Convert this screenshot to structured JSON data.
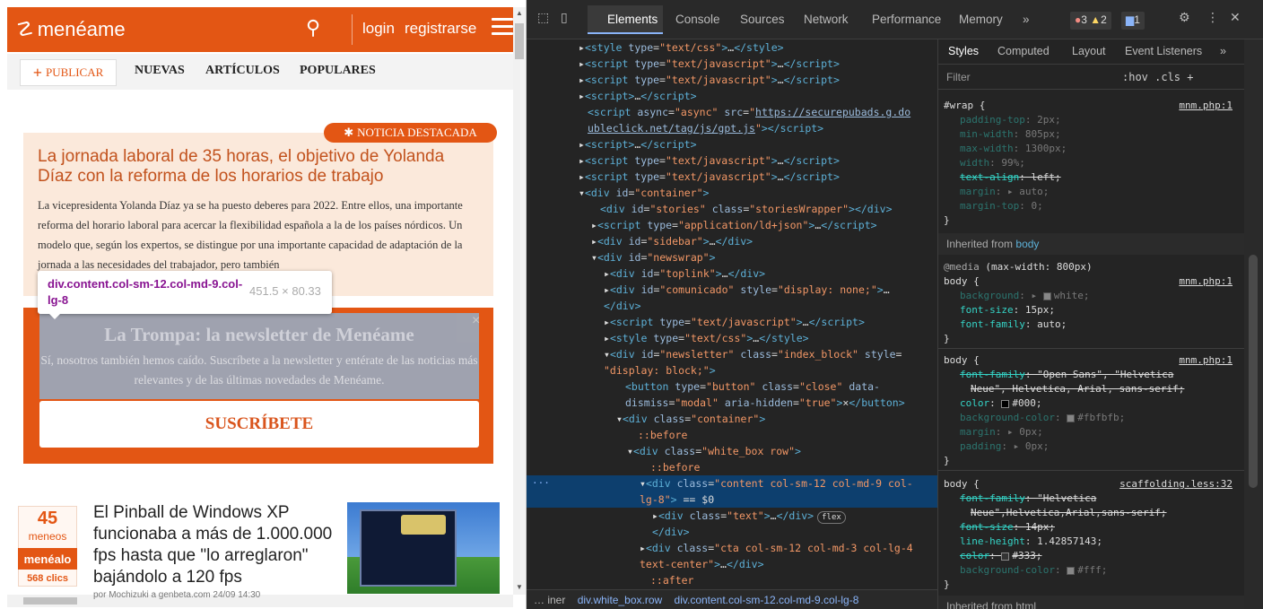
{
  "page": {
    "logo": "menéame",
    "login": "login",
    "register": "registrarse",
    "publish": "PUBLICAR",
    "nav": [
      "NUEVAS",
      "ARTÍCULOS",
      "POPULARES"
    ],
    "featured_badge": "NOTICIA DESTACADA",
    "featured_title": "La jornada laboral de 35 horas, el objetivo de Yolanda Díaz con la reforma de los horarios de trabajo",
    "featured_body": "La vicepresidenta Yolanda Díaz ya se ha puesto deberes para 2022. Entre ellos, una importante reforma del horario laboral para acercar la flexibilidad española a la de los países nórdicos. Un modelo que, según los expertos, se distingue por una importante capacidad de adaptación de la jornada a las necesidades del trabajador, pero también",
    "tooltip_selector": "div.content.col-sm-12.col-md-9.col-lg-8",
    "tooltip_dims": "451.5 × 80.33",
    "newsletter_title": "La Trompa: la newsletter de Menéame",
    "newsletter_text": "Sí, nosotros también hemos caído. Suscríbete a la newsletter y entérate de las noticias más relevantes y de las últimas novedades de Menéame.",
    "newsletter_close": "×",
    "newsletter_button": "SUSCRÍBETE",
    "story": {
      "votes": "45",
      "votes_label": "meneos",
      "vote_button": "menéalo",
      "clicks": "568 clics",
      "title": "El Pinball de Windows XP funcionaba a más de 1.000.000 fps hasta que \"lo arreglaron\" bajándolo a 120 fps",
      "meta": "por Mochizuki a genbeta.com   24/09 14:30"
    }
  },
  "devtools": {
    "tabs": [
      "Elements",
      "Console",
      "Sources",
      "Network",
      "Performance",
      "Memory",
      "»"
    ],
    "errors": "3",
    "warnings": "2",
    "messages": "1",
    "breadcrumb": [
      "… iner",
      "div.white_box.row",
      "div.content.col-sm-12.col-md-9.col-lg-8"
    ],
    "styles_tabs": [
      "Styles",
      "Computed",
      "Layout",
      "Event Listeners",
      "»"
    ],
    "filter_placeholder": "Filter",
    "filter_tools": ":hov  .cls  +",
    "inherited_label": "Inherited from",
    "inherited_from": "body",
    "inherited_bottom": "Inherited from html"
  },
  "colors": {
    "accent": "#e35614",
    "devtools_bg": "#242424",
    "selected_row": "#0d3f6e"
  }
}
